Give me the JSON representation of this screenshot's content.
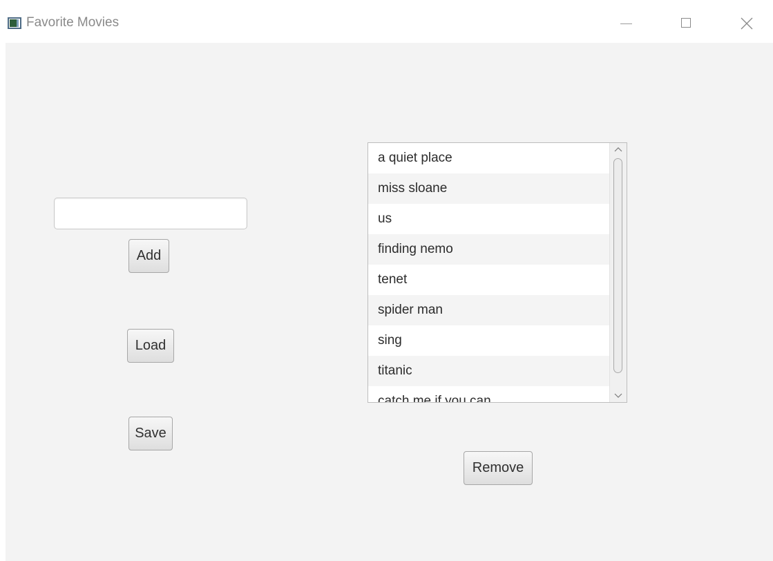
{
  "window": {
    "title": "Favorite Movies",
    "icon": "java-app-icon",
    "controls": [
      "minimize-icon",
      "maximize-icon",
      "close-icon"
    ]
  },
  "movie_input": {
    "value": "",
    "placeholder": ""
  },
  "buttons": {
    "add": "Add",
    "load": "Load",
    "save": "Save",
    "remove": "Remove"
  },
  "movie_list": {
    "items": [
      "a quiet place",
      "miss sloane",
      "us",
      "finding nemo",
      "tenet",
      "spider man",
      "sing",
      "titanic",
      "catch me if you can"
    ]
  }
}
